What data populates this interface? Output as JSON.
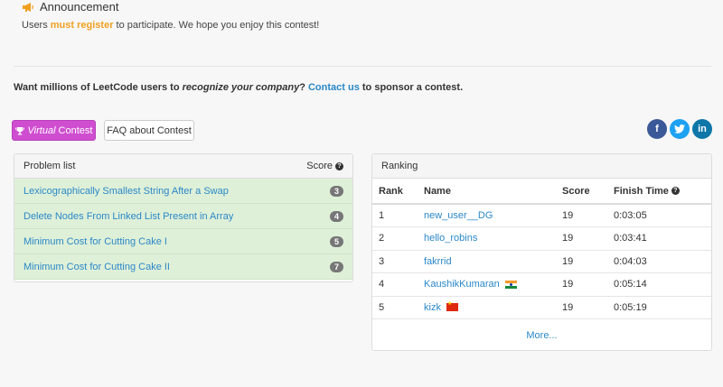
{
  "announcement": {
    "title": "Announcement",
    "text_before": "Users ",
    "highlight": "must register",
    "text_after": " to participate. We hope you enjoy this contest!"
  },
  "sponsor": {
    "part1": "Want millions of LeetCode users to ",
    "em": "recognize your company",
    "part2": "? ",
    "link": "Contact us",
    "part3": " to sponsor a contest."
  },
  "buttons": {
    "virtual_em": "Virtual",
    "virtual_label": "Contest",
    "faq_label": "FAQ about Contest"
  },
  "social": {
    "facebook": "f",
    "twitter": "t",
    "linkedin": "in"
  },
  "problems": {
    "header_title": "Problem list",
    "header_score": "Score",
    "items": [
      {
        "title": "Lexicographically Smallest String After a Swap",
        "score": "3"
      },
      {
        "title": "Delete Nodes From Linked List Present in Array",
        "score": "4"
      },
      {
        "title": "Minimum Cost for Cutting Cake I",
        "score": "5"
      },
      {
        "title": "Minimum Cost for Cutting Cake II",
        "score": "7"
      }
    ]
  },
  "ranking": {
    "header_title": "Ranking",
    "columns": {
      "rank": "Rank",
      "name": "Name",
      "score": "Score",
      "finish": "Finish Time"
    },
    "rows": [
      {
        "rank": "1",
        "name": "new_user__DG",
        "score": "19",
        "finish": "0:03:05",
        "flag": ""
      },
      {
        "rank": "2",
        "name": "hello_robins",
        "score": "19",
        "finish": "0:03:41",
        "flag": ""
      },
      {
        "rank": "3",
        "name": "fakrrid",
        "score": "19",
        "finish": "0:04:03",
        "flag": ""
      },
      {
        "rank": "4",
        "name": "KaushikKumaran",
        "score": "19",
        "finish": "0:05:14",
        "flag": "india-flag-icon"
      },
      {
        "rank": "5",
        "name": "kizk",
        "score": "19",
        "finish": "0:05:19",
        "flag": "china-flag-icon"
      }
    ],
    "more": "More..."
  },
  "colors": {
    "accent_link": "#2a88c8",
    "virtual_button": "#cf4ed0",
    "highlight_orange": "#f0a020",
    "problem_row_bg": "#dff0d8"
  }
}
